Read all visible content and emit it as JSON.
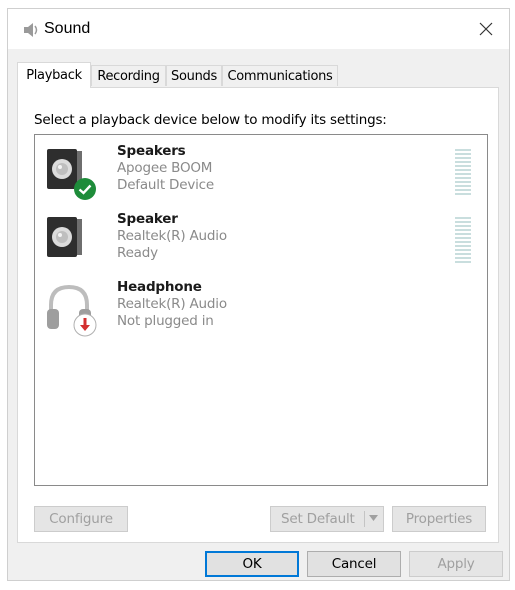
{
  "window": {
    "title": "Sound",
    "icon": "speaker-icon",
    "close_icon": "close-icon"
  },
  "tabs": [
    {
      "label": "Playback",
      "active": true
    },
    {
      "label": "Recording",
      "active": false
    },
    {
      "label": "Sounds",
      "active": false
    },
    {
      "label": "Communications",
      "active": false
    }
  ],
  "panel": {
    "instruction": "Select a playback device below to modify its settings:",
    "devices": [
      {
        "name": "Speakers",
        "detail": "Apogee BOOM",
        "status": "Default Device",
        "icon": "speaker-icon",
        "badge": "default-check-icon"
      },
      {
        "name": "Speaker",
        "detail": "Realtek(R) Audio",
        "status": "Ready",
        "icon": "speaker-icon"
      },
      {
        "name": "Headphone",
        "detail": "Realtek(R) Audio",
        "status": "Not plugged in",
        "icon": "headphone-icon",
        "badge": "unplugged-arrow-icon"
      }
    ],
    "buttons": {
      "configure": "Configure",
      "set_default": "Set Default",
      "properties": "Properties"
    }
  },
  "footer": {
    "ok": "OK",
    "cancel": "Cancel",
    "apply": "Apply"
  },
  "colors": {
    "accent": "#0078d7",
    "default_badge": "#1e8c3a",
    "unplugged_badge": "#d32f2f",
    "disabled_text": "#a0a0a0"
  }
}
